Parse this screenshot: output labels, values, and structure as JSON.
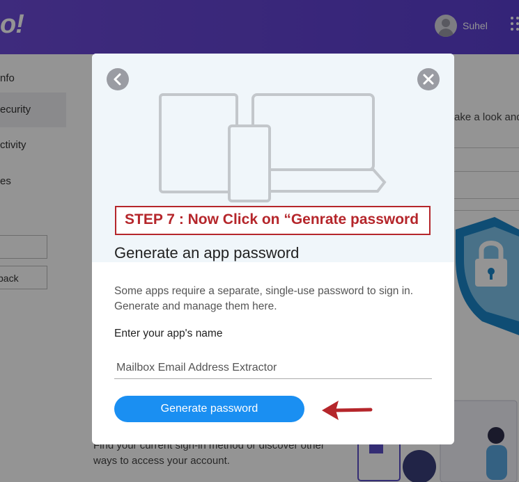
{
  "header": {
    "logo_text": "o!",
    "username": "Suhel",
    "brand_color": "#5f3fd1"
  },
  "sidebar": {
    "items": [
      {
        "label": "nfo"
      },
      {
        "label": "ecurity"
      },
      {
        "label": "ctivity"
      },
      {
        "label": "es"
      }
    ],
    "box_back_label": "back"
  },
  "background": {
    "right_text": "ake a look and",
    "bottom_text_line1": "Find your current sign-in method or discover other",
    "bottom_text_line2": "ways to access your account."
  },
  "modal": {
    "step_annotation": "STEP 7 : Now Click on “Genrate password",
    "title": "Generate an app password",
    "description": "Some apps require a separate, single-use password to sign in. Generate and manage them here.",
    "field_label": "Enter your app's name",
    "app_name_value": "Mailbox Email Address Extractor",
    "generate_button_label": "Generate password",
    "accent_color": "#1a8ff2",
    "annotation_color": "#b5262b"
  },
  "icons": {
    "back": "chevron-left-icon",
    "close": "close-icon",
    "arrow": "arrow-left-icon"
  }
}
